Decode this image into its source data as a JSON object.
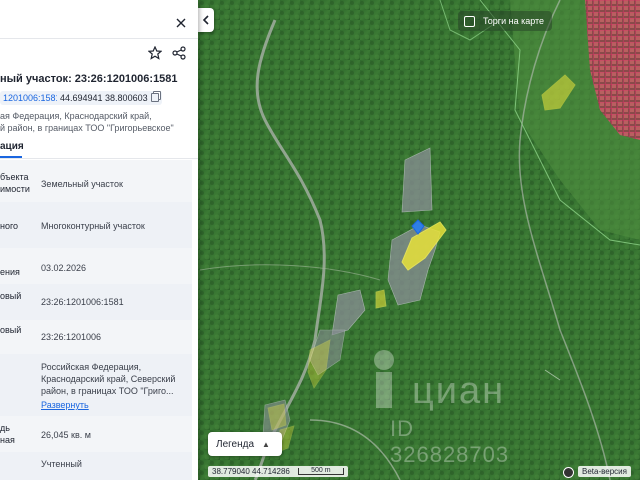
{
  "panel": {
    "title": "Земельный участок: 23:26:1201006:1581",
    "title_visible": "ный участок: 23:26:1201006:1581",
    "cadastral_chip": "1201006:1581",
    "coords_chip": "44.694941 38.800603",
    "address_line1": "ая Федерация, Краснодарский край,",
    "address_line2": "й район, в границах ТОО \"Григорьевское\"",
    "active_tab": "ация",
    "rows": [
      {
        "label_lines": [
          "бъекта",
          "имости"
        ],
        "value_lines": [
          "Земельный участок"
        ]
      },
      {
        "label_lines": [
          "ного"
        ],
        "value_lines": [
          "Многоконтурный участок"
        ]
      },
      {
        "label_lines": [
          "ения"
        ],
        "value_lines": [
          "03.02.2026"
        ]
      },
      {
        "label_lines": [
          "овый"
        ],
        "value_lines": [
          "23:26:1201006:1581"
        ]
      },
      {
        "label_lines": [
          "овый",
          ""
        ],
        "value_lines": [
          "23:26:1201006"
        ]
      },
      {
        "label_lines": [
          ""
        ],
        "value_lines": [
          "Российская Федерация,",
          "Краснодарский край, Северский",
          "район, в границах ТОО \"Григо..."
        ],
        "link": "Развернуть"
      },
      {
        "label_lines": [
          "дь",
          "ная"
        ],
        "value_lines": [
          "26,045 кв. м"
        ]
      },
      {
        "label_lines": [
          ""
        ],
        "value_lines": [
          "Учтенный"
        ]
      }
    ]
  },
  "map": {
    "torgi_label": "Торги на карте",
    "legend_label": "Легенда",
    "coords_readout": "38.779040  44.714286",
    "scale_label": "500 m",
    "beta_label": "Beta-версия",
    "watermark_brand": "циан",
    "watermark_id": "ID 326828703"
  },
  "icons": {
    "close": "close-icon",
    "star": "star-icon",
    "share": "share-icon",
    "collapse": "chevron-left-icon"
  },
  "colors": {
    "accent": "#1a66e0",
    "plot_yellow": "#e8e23a",
    "plot_gray": "#8a8f96",
    "parcel_pink": "#d9306a"
  }
}
